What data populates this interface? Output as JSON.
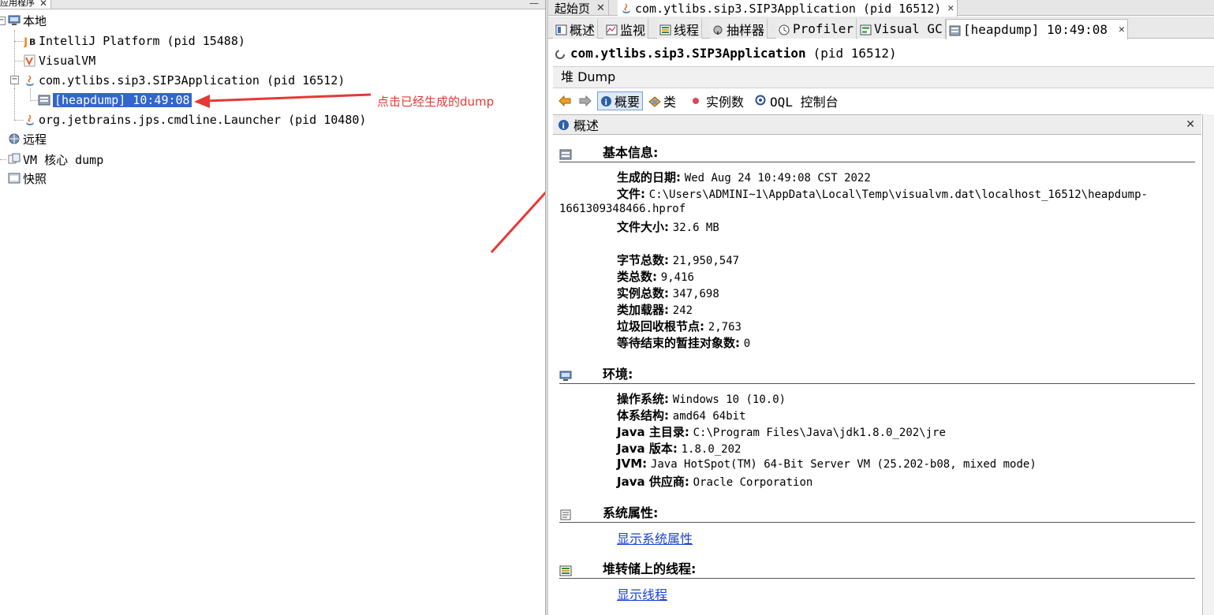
{
  "left_panel": {
    "tab_label": "应用程序",
    "tab_close": "✕",
    "minimize": "—",
    "tree": {
      "local": "本地",
      "intellij": "IntelliJ Platform (pid 15488)",
      "visualvm": "VisualVM",
      "sip3app": "com.ytlibs.sip3.SIP3Application (pid 16512)",
      "heapdump": "[heapdump] 10:49:08",
      "launcher": "org.jetbrains.jps.cmdline.Launcher (pid 10480)",
      "remote": "远程",
      "vm_core": "VM 核心 dump",
      "snapshots": "快照"
    },
    "annotation": "点击已经生成的dump"
  },
  "top_tabs": [
    {
      "label": "起始页",
      "close": "✕"
    },
    {
      "label": "com.ytlibs.sip3.SIP3Application (pid 16512)",
      "close": "✕"
    }
  ],
  "view_tabs": {
    "overview": "概述",
    "monitor": "监视",
    "threads": "线程",
    "sampler": "抽样器",
    "profiler": "Profiler",
    "visualgc": "Visual GC",
    "heapdump": "[heapdump] 10:49:08",
    "close": "✕"
  },
  "app_title": {
    "name": "com.ytlibs.sip3.SIP3Application",
    "pid": "(pid 16512)"
  },
  "heap_dump_label": "堆 Dump",
  "toolbar": {
    "summary": "概要",
    "classes": "类",
    "instances": "实例数",
    "oql": "OQL 控制台"
  },
  "summary_panel": {
    "title": "概述",
    "close": "✕"
  },
  "basic_info": {
    "title": "基本信息:",
    "date_label": "生成的日期:",
    "date_value": "Wed Aug 24 10:49:08 CST 2022",
    "file_label": "文件:",
    "file_value": "C:\\Users\\ADMINI~1\\AppData\\Local\\Temp\\visualvm.dat\\localhost_16512\\heapdump-",
    "file_value_cont": "1661309348466.hprof",
    "size_label": "文件大小:",
    "size_value": "32.6 MB",
    "bytes_label": "字节总数:",
    "bytes_value": "21,950,547",
    "classes_label": "类总数:",
    "classes_value": "9,416",
    "instances_label": "实例总数:",
    "instances_value": "347,698",
    "classloaders_label": "类加载器:",
    "classloaders_value": "242",
    "gcroots_label": "垃圾回收根节点:",
    "gcroots_value": "2,763",
    "pending_label": "等待结束的暂挂对象数:",
    "pending_value": "0"
  },
  "environment": {
    "title": "环境:",
    "os_label": "操作系统:",
    "os_value": "Windows 10 (10.0)",
    "arch_label": "体系结构:",
    "arch_value": "amd64 64bit",
    "home_label": "Java 主目录:",
    "home_value": "C:\\Program Files\\Java\\jdk1.8.0_202\\jre",
    "version_label": "Java 版本:",
    "version_value": "1.8.0_202",
    "jvm_label": "JVM:",
    "jvm_value": "Java HotSpot(TM) 64-Bit Server VM (25.202-b08, mixed mode)",
    "vendor_label": "Java 供应商:",
    "vendor_value": "Oracle Corporation"
  },
  "sys_props": {
    "title": "系统属性:",
    "link": "显示系统属性"
  },
  "threads_section": {
    "title": "堆转储上的线程:",
    "link": "显示线程"
  },
  "colors": {
    "selection": "#3366cc",
    "annotation": "#e53935",
    "link": "#1a3fd6"
  }
}
